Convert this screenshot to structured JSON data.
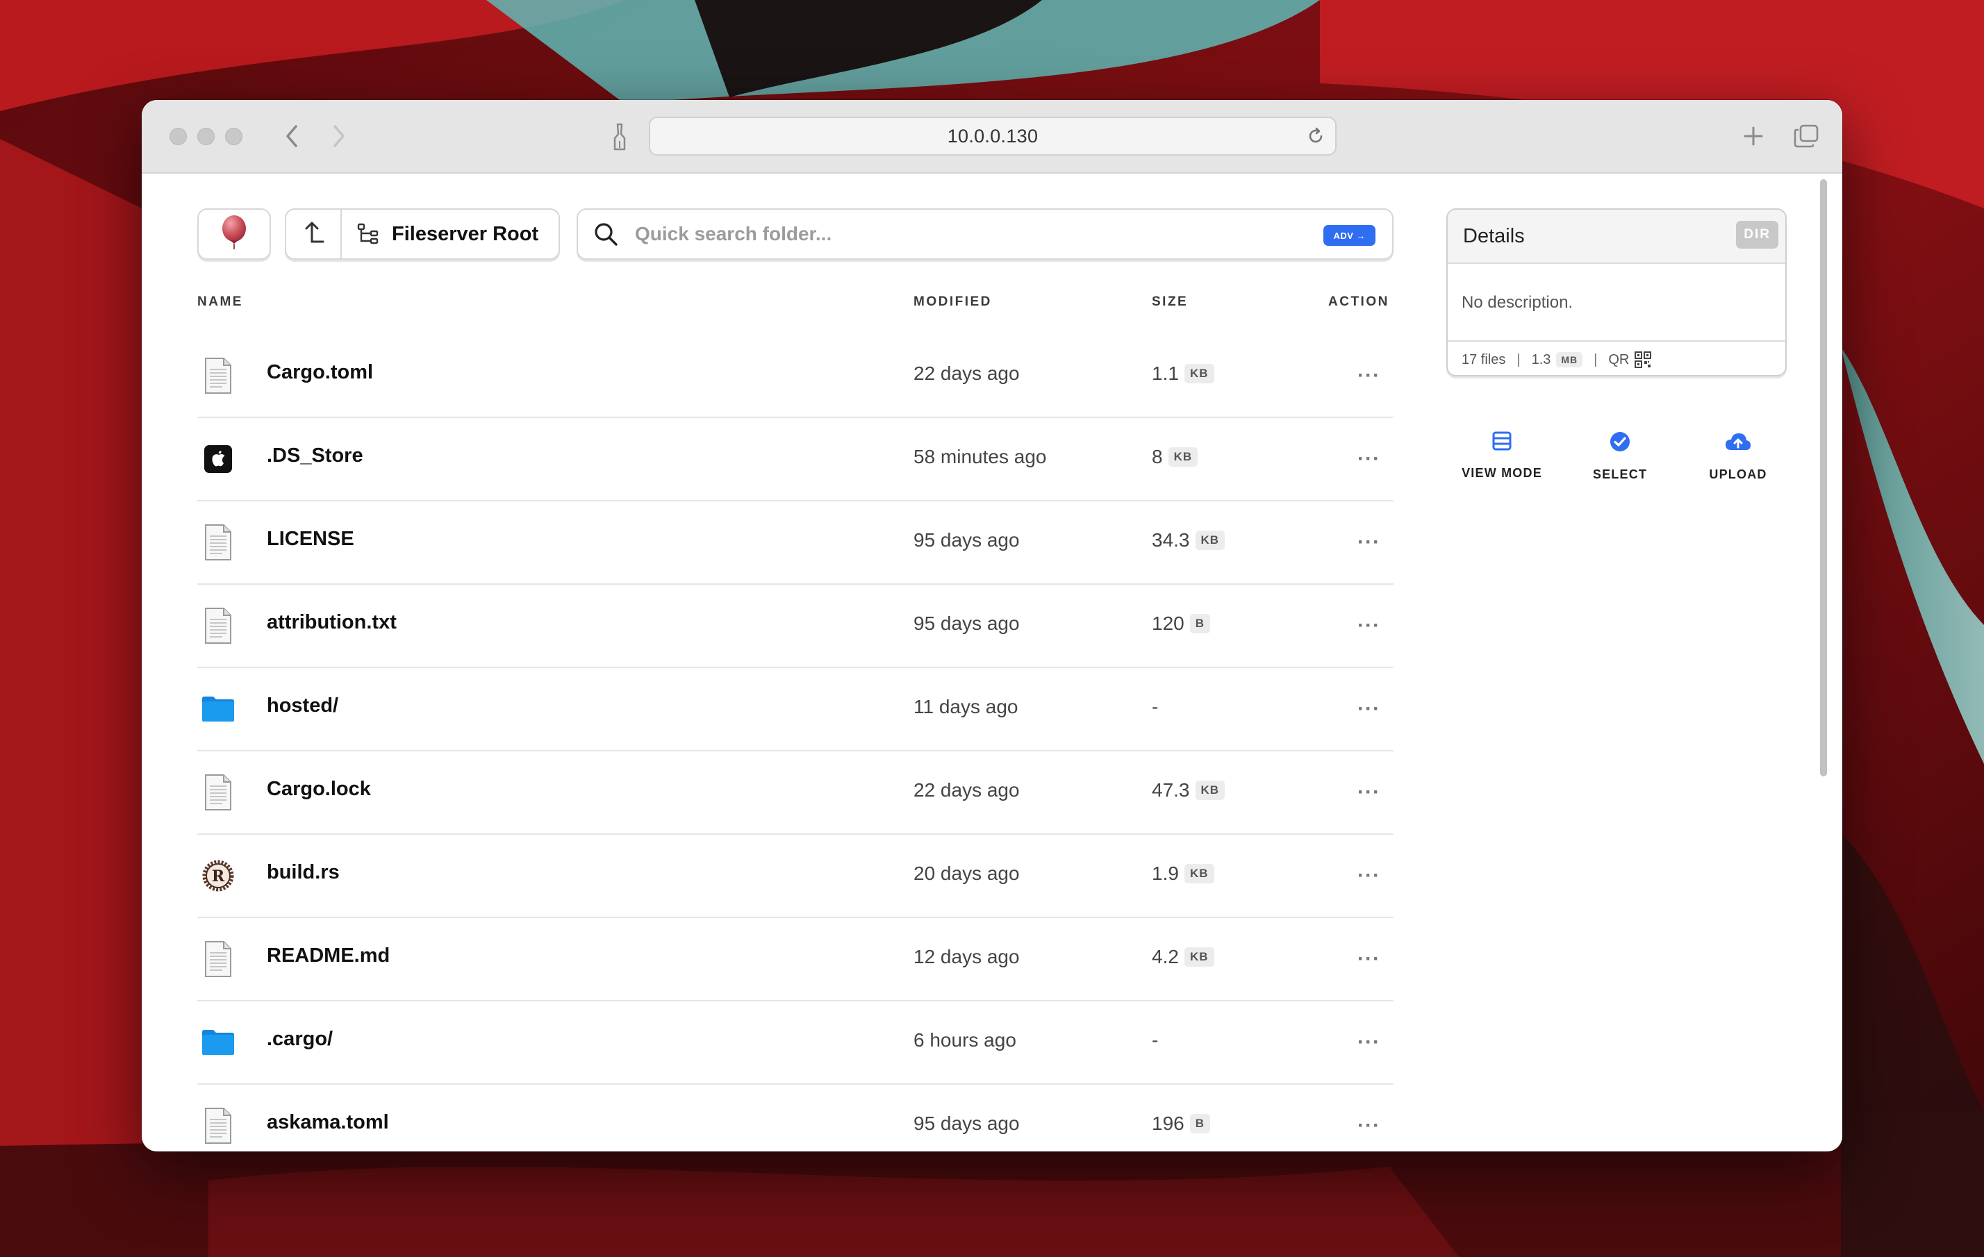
{
  "browser": {
    "address": "10.0.0.130"
  },
  "toolbar": {
    "root_label": "Fileserver Root",
    "search_placeholder": "Quick search folder...",
    "adv_label": "ADV →"
  },
  "table": {
    "headers": {
      "name": "NAME",
      "modified": "MODIFIED",
      "size": "SIZE",
      "action": "ACTION"
    },
    "rows": [
      {
        "name": "Cargo.toml",
        "modified": "22 days ago",
        "size": "1.1",
        "unit": "KB",
        "icon": "text-file-icon"
      },
      {
        "name": ".DS_Store",
        "modified": "58 minutes ago",
        "size": "8",
        "unit": "KB",
        "icon": "apple-file-icon"
      },
      {
        "name": "LICENSE",
        "modified": "95 days ago",
        "size": "34.3",
        "unit": "KB",
        "icon": "text-file-icon"
      },
      {
        "name": "attribution.txt",
        "modified": "95 days ago",
        "size": "120",
        "unit": "B",
        "icon": "text-file-icon"
      },
      {
        "name": "hosted/",
        "modified": "11 days ago",
        "size": "-",
        "unit": "",
        "icon": "folder-icon"
      },
      {
        "name": "Cargo.lock",
        "modified": "22 days ago",
        "size": "47.3",
        "unit": "KB",
        "icon": "text-file-icon"
      },
      {
        "name": "build.rs",
        "modified": "20 days ago",
        "size": "1.9",
        "unit": "KB",
        "icon": "rust-file-icon"
      },
      {
        "name": "README.md",
        "modified": "12 days ago",
        "size": "4.2",
        "unit": "KB",
        "icon": "text-file-icon"
      },
      {
        "name": ".cargo/",
        "modified": "6 hours ago",
        "size": "-",
        "unit": "",
        "icon": "folder-icon"
      },
      {
        "name": "askama.toml",
        "modified": "95 days ago",
        "size": "196",
        "unit": "B",
        "icon": "text-file-icon"
      }
    ],
    "row_action": "···"
  },
  "details": {
    "title": "Details",
    "badge": "DIR",
    "description": "No description.",
    "file_count": "17 files",
    "sep": "|",
    "total_size": "1.3",
    "total_unit": "MB",
    "qr_label": "QR"
  },
  "actions": {
    "view_mode": "VIEW MODE",
    "select": "SELECT",
    "upload": "UPLOAD"
  },
  "colors": {
    "accent": "#2f6df1",
    "folder": "#1a9bf0"
  }
}
